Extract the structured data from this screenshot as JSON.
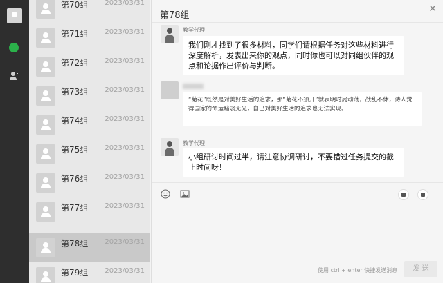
{
  "list": {
    "items": [
      {
        "name": "第70组",
        "date": "2023/03/31"
      },
      {
        "name": "第71组",
        "date": "2023/03/31"
      },
      {
        "name": "第72组",
        "date": "2023/03/31"
      },
      {
        "name": "第73组",
        "date": "2023/03/31"
      },
      {
        "name": "第74组",
        "date": "2023/03/31"
      },
      {
        "name": "第75组",
        "date": "2023/03/31"
      },
      {
        "name": "第76组",
        "date": "2023/03/31"
      },
      {
        "name": "第77组",
        "date": "2023/03/31"
      },
      {
        "name": "第78组",
        "date": "2023/03/31"
      },
      {
        "name": "第79组",
        "date": "2023/03/31"
      }
    ],
    "active_index": 8
  },
  "chat": {
    "title": "第78组",
    "messages": [
      {
        "sender": "教学代理",
        "text": "我们刚才找到了很多材料，同学们请根据任务对这些材料进行深度解析，发表出来你的观点，同时你也可以对同组伙伴的观点和论据作出评价与判断。"
      },
      {
        "sender": "",
        "text": "“菊花”既然是对美好生活的追求，那“菊花不须开”就表明时局动荡，战乱不休，诗人觉得国家的命运黯淡无光，自己对美好生活的追求也无法实现。"
      },
      {
        "sender": "教学代理",
        "text": "小组研讨时间过半，请注意协调研讨，不要错过任务提交的截止时间呀！"
      }
    ],
    "input_hint": "使用 ctrl + enter 快捷发送消息",
    "send_label": "发 送"
  },
  "icons": {
    "rail": [
      "user-avatar-icon",
      "chat-icon",
      "contacts-icon"
    ],
    "toolbar": [
      "emoji-icon",
      "image-icon"
    ],
    "close": "close-icon"
  },
  "colors": {
    "rail_bg": "#2e2e2e",
    "online": "#2bb14a",
    "active_row": "#c9c9c9"
  }
}
